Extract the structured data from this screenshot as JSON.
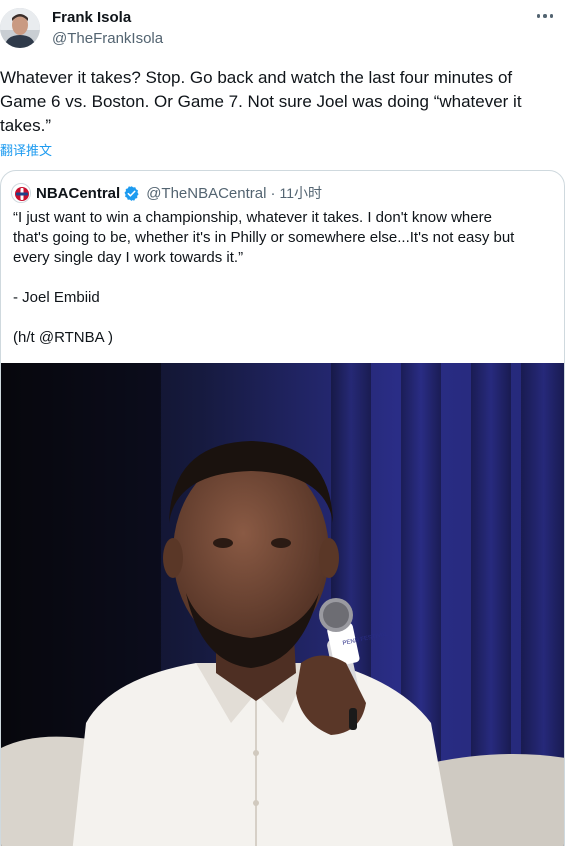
{
  "author": {
    "name": "Frank Isola",
    "handle": "@TheFrankIsola",
    "avatar_icon": "person-avatar-icon"
  },
  "tweet": {
    "text": "Whatever it takes? Stop. Go back and watch the last four minutes of Game 6 vs. Boston. Or Game 7. Not sure Joel was doing “whatever it takes.”",
    "translate_label": "翻译推文",
    "more_icon": "more-options-icon"
  },
  "quoted": {
    "name": "NBACentral",
    "handle": "@TheNBACentral",
    "separator": "·",
    "time": "11小时",
    "verified_icon": "verified-badge-icon",
    "verified_color": "#1d9bf0",
    "text_lines": [
      "“I just want to win a championship, whatever it takes. I don't know where",
      "that's going to be, whether it's in Philly or somewhere else...It's not easy but",
      "every single day I work towards it.”"
    ],
    "signature": "- Joel Embiid",
    "hat_tip": "(h/t @RTNBA )",
    "photo": {
      "icon": "speaker-photo",
      "mic_flag_text": "PENN FESTIVAL"
    }
  },
  "colors": {
    "text": "#0f1419",
    "secondary": "#536471",
    "link": "#1d9bf0",
    "border": "#cfd9de"
  }
}
